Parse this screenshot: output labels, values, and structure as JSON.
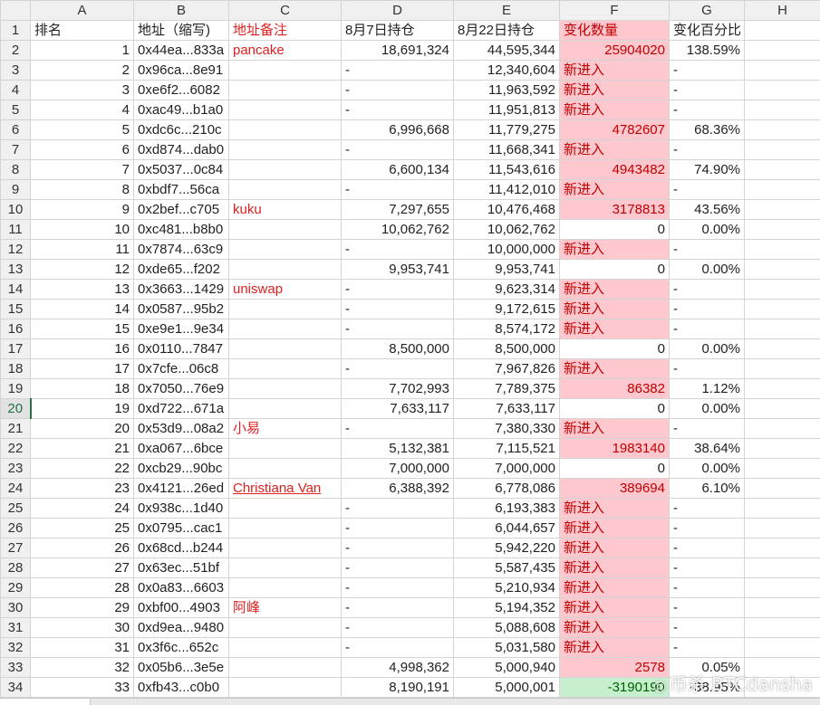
{
  "columns": [
    "A",
    "B",
    "C",
    "D",
    "E",
    "F",
    "G",
    "H"
  ],
  "header": {
    "row_number": "1",
    "cells": [
      "排名",
      "地址（缩写)",
      "地址备注",
      "8月7日持仓",
      "8月22日持仓",
      "变化数量",
      "变化百分比",
      ""
    ]
  },
  "active_row": "20",
  "rows": [
    {
      "n": "2",
      "rank": "1",
      "addr": "0x44ea...833a",
      "note": "pancake",
      "aug7": "18,691,324",
      "aug22": "44,595,344",
      "chg": "25904020",
      "pct": "138.59%",
      "fill": "pink"
    },
    {
      "n": "3",
      "rank": "2",
      "addr": "0x96ca...8e91",
      "note": "",
      "aug7": "-",
      "aug22": "12,340,604",
      "chg": "新进入",
      "pct": "-",
      "fill": "pink"
    },
    {
      "n": "4",
      "rank": "3",
      "addr": "0xe6f2...6082",
      "note": "",
      "aug7": "-",
      "aug22": "11,963,592",
      "chg": "新进入",
      "pct": "-",
      "fill": "pink"
    },
    {
      "n": "5",
      "rank": "4",
      "addr": "0xac49...b1a0",
      "note": "",
      "aug7": "-",
      "aug22": "11,951,813",
      "chg": "新进入",
      "pct": "-",
      "fill": "pink"
    },
    {
      "n": "6",
      "rank": "5",
      "addr": "0xdc6c...210c",
      "note": "",
      "aug7": "6,996,668",
      "aug22": "11,779,275",
      "chg": "4782607",
      "pct": "68.36%",
      "fill": "pink"
    },
    {
      "n": "7",
      "rank": "6",
      "addr": "0xd874...dab0",
      "note": "",
      "aug7": "-",
      "aug22": "11,668,341",
      "chg": "新进入",
      "pct": "-",
      "fill": "pink"
    },
    {
      "n": "8",
      "rank": "7",
      "addr": "0x5037...0c84",
      "note": "",
      "aug7": "6,600,134",
      "aug22": "11,543,616",
      "chg": "4943482",
      "pct": "74.90%",
      "fill": "pink"
    },
    {
      "n": "9",
      "rank": "8",
      "addr": "0xbdf7...56ca",
      "note": "",
      "aug7": "-",
      "aug22": "11,412,010",
      "chg": "新进入",
      "pct": "-",
      "fill": "pink"
    },
    {
      "n": "10",
      "rank": "9",
      "addr": "0x2bef...c705",
      "note": "kuku",
      "aug7": "7,297,655",
      "aug22": "10,476,468",
      "chg": "3178813",
      "pct": "43.56%",
      "fill": "pink"
    },
    {
      "n": "11",
      "rank": "10",
      "addr": "0xc481...b8b0",
      "note": "",
      "aug7": "10,062,762",
      "aug22": "10,062,762",
      "chg": "0",
      "pct": "0.00%",
      "fill": "none"
    },
    {
      "n": "12",
      "rank": "11",
      "addr": "0x7874...63c9",
      "note": "",
      "aug7": "-",
      "aug22": "10,000,000",
      "chg": "新进入",
      "pct": "-",
      "fill": "pink"
    },
    {
      "n": "13",
      "rank": "12",
      "addr": "0xde65...f202",
      "note": "",
      "aug7": "9,953,741",
      "aug22": "9,953,741",
      "chg": "0",
      "pct": "0.00%",
      "fill": "none"
    },
    {
      "n": "14",
      "rank": "13",
      "addr": "0x3663...1429",
      "note": "uniswap",
      "aug7": "-",
      "aug22": "9,623,314",
      "chg": "新进入",
      "pct": "-",
      "fill": "pink"
    },
    {
      "n": "15",
      "rank": "14",
      "addr": "0x0587...95b2",
      "note": "",
      "aug7": "-",
      "aug22": "9,172,615",
      "chg": "新进入",
      "pct": "-",
      "fill": "pink"
    },
    {
      "n": "16",
      "rank": "15",
      "addr": "0xe9e1...9e34",
      "note": "",
      "aug7": "-",
      "aug22": "8,574,172",
      "chg": "新进入",
      "pct": "-",
      "fill": "pink"
    },
    {
      "n": "17",
      "rank": "16",
      "addr": "0x0110...7847",
      "note": "",
      "aug7": "8,500,000",
      "aug22": "8,500,000",
      "chg": "0",
      "pct": "0.00%",
      "fill": "none"
    },
    {
      "n": "18",
      "rank": "17",
      "addr": "0x7cfe...06c8",
      "note": "",
      "aug7": "-",
      "aug22": "7,967,826",
      "chg": "新进入",
      "pct": "-",
      "fill": "pink"
    },
    {
      "n": "19",
      "rank": "18",
      "addr": "0x7050...76e9",
      "note": "",
      "aug7": "7,702,993",
      "aug22": "7,789,375",
      "chg": "86382",
      "pct": "1.12%",
      "fill": "pink"
    },
    {
      "n": "20",
      "rank": "19",
      "addr": "0xd722...671a",
      "note": "",
      "aug7": "7,633,117",
      "aug22": "7,633,117",
      "chg": "0",
      "pct": "0.00%",
      "fill": "none"
    },
    {
      "n": "21",
      "rank": "20",
      "addr": "0x53d9...08a2",
      "note": "小易",
      "aug7": "-",
      "aug22": "7,380,330",
      "chg": "新进入",
      "pct": "-",
      "fill": "pink"
    },
    {
      "n": "22",
      "rank": "21",
      "addr": "0xa067...6bce",
      "note": "",
      "aug7": "5,132,381",
      "aug22": "7,115,521",
      "chg": "1983140",
      "pct": "38.64%",
      "fill": "pink"
    },
    {
      "n": "23",
      "rank": "22",
      "addr": "0xcb29...90bc",
      "note": "",
      "aug7": "7,000,000",
      "aug22": "7,000,000",
      "chg": "0",
      "pct": "0.00%",
      "fill": "none"
    },
    {
      "n": "24",
      "rank": "23",
      "addr": "0x4121...26ed",
      "note": "Christiana Van",
      "aug7": "6,388,392",
      "aug22": "6,778,086",
      "chg": "389694",
      "pct": "6.10%",
      "fill": "pink",
      "underline": true
    },
    {
      "n": "25",
      "rank": "24",
      "addr": "0x938c...1d40",
      "note": "",
      "aug7": "-",
      "aug22": "6,193,383",
      "chg": "新进入",
      "pct": "-",
      "fill": "pink"
    },
    {
      "n": "26",
      "rank": "25",
      "addr": "0x0795...cac1",
      "note": "",
      "aug7": "-",
      "aug22": "6,044,657",
      "chg": "新进入",
      "pct": "-",
      "fill": "pink"
    },
    {
      "n": "27",
      "rank": "26",
      "addr": "0x68cd...b244",
      "note": "",
      "aug7": "-",
      "aug22": "5,942,220",
      "chg": "新进入",
      "pct": "-",
      "fill": "pink"
    },
    {
      "n": "28",
      "rank": "27",
      "addr": "0x63ec...51bf",
      "note": "",
      "aug7": "-",
      "aug22": "5,587,435",
      "chg": "新进入",
      "pct": "-",
      "fill": "pink"
    },
    {
      "n": "29",
      "rank": "28",
      "addr": "0x0a83...6603",
      "note": "",
      "aug7": "-",
      "aug22": "5,210,934",
      "chg": "新进入",
      "pct": "-",
      "fill": "pink"
    },
    {
      "n": "30",
      "rank": "29",
      "addr": "0xbf00...4903",
      "note": "阿峰",
      "aug7": "-",
      "aug22": "5,194,352",
      "chg": "新进入",
      "pct": "-",
      "fill": "pink"
    },
    {
      "n": "31",
      "rank": "30",
      "addr": "0xd9ea...9480",
      "note": "",
      "aug7": "-",
      "aug22": "5,088,608",
      "chg": "新进入",
      "pct": "-",
      "fill": "pink"
    },
    {
      "n": "32",
      "rank": "31",
      "addr": "0x3f6c...652c",
      "note": "",
      "aug7": "-",
      "aug22": "5,031,580",
      "chg": "新进入",
      "pct": "-",
      "fill": "pink"
    },
    {
      "n": "33",
      "rank": "32",
      "addr": "0x05b6...3e5e",
      "note": "",
      "aug7": "4,998,362",
      "aug22": "5,000,940",
      "chg": "2578",
      "pct": "0.05%",
      "fill": "pink"
    },
    {
      "n": "34",
      "rank": "33",
      "addr": "0xfb43...c0b0",
      "note": "",
      "aug7": "8,190,191",
      "aug22": "5,000,001",
      "chg": "-3190190",
      "pct": "-38.95%",
      "fill": "green"
    }
  ],
  "watermark": {
    "icon": "wechat-icon",
    "text": "币杀 BTCdansha"
  },
  "colors": {
    "pink_fill": "#ffc7ce",
    "pink_text": "#c00000",
    "green_fill": "#c6efce",
    "green_text": "#006100",
    "note_red": "#e02020",
    "header_gray": "#f0f0f0"
  }
}
